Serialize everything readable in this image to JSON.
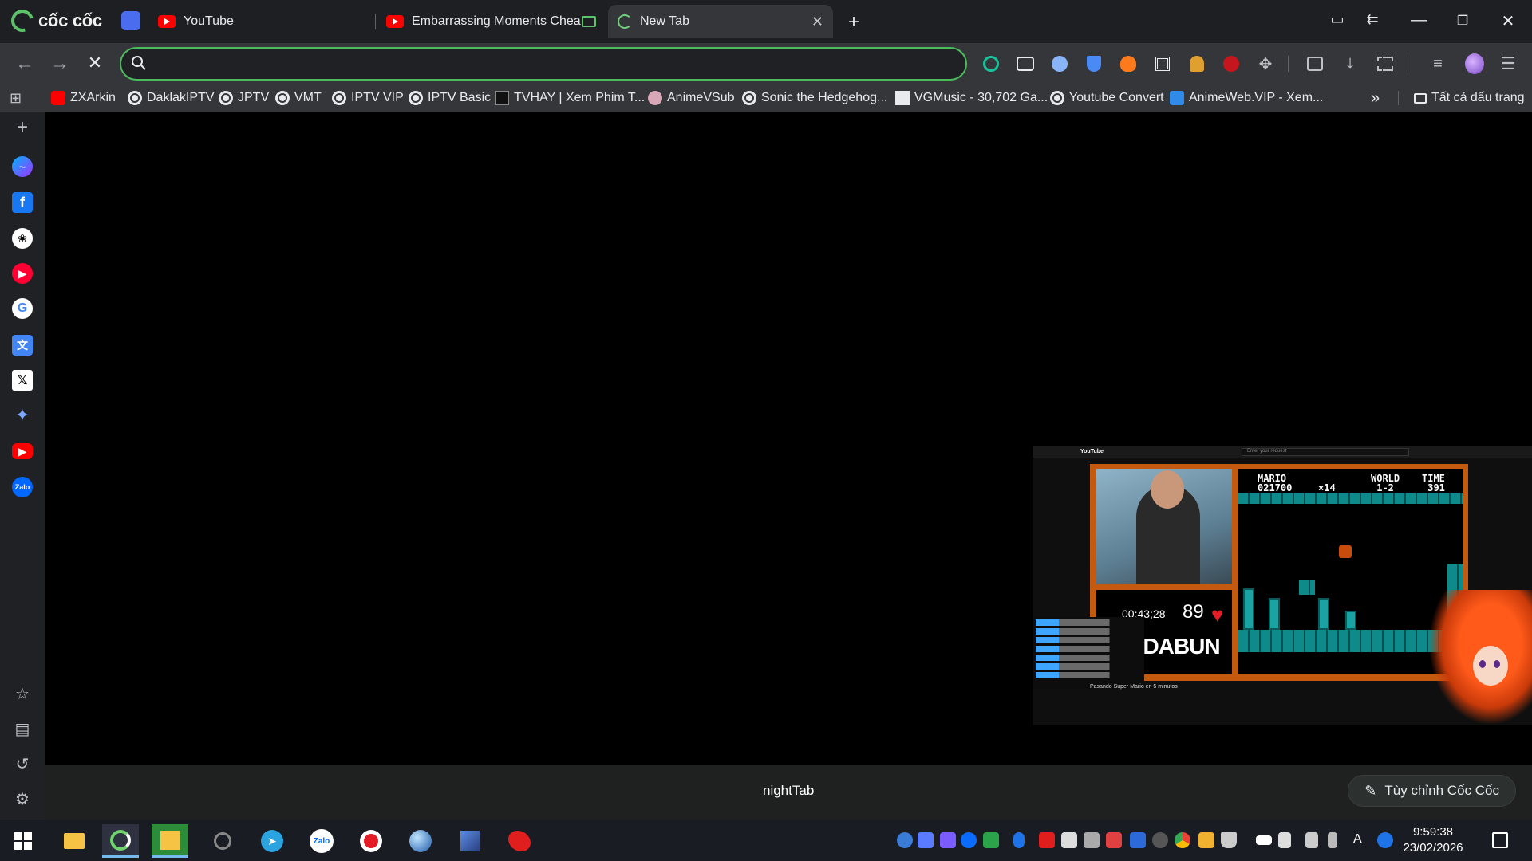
{
  "browser": {
    "brand_name": "cốc cốc",
    "tabs": [
      {
        "label": "YouTube",
        "icon": "youtube-icon"
      },
      {
        "label": "Embarrassing Moments Chea",
        "icon": "youtube-icon",
        "pip_indicator": true
      },
      {
        "label": "New Tab",
        "icon": "loading-spinner-icon",
        "active": true
      }
    ],
    "window_controls": [
      "minimize",
      "restore",
      "close"
    ]
  },
  "omnibox": {
    "value": "",
    "placeholder": "",
    "icon": "search-icon"
  },
  "extensions": [
    "grammarly-icon",
    "vpn-glasses-icon",
    "circle-icon",
    "shield-icon",
    "coccoc-fox-icon",
    "qr-icon",
    "people-icon",
    "adblock-icon",
    "puzzle-icon",
    "split-view-icon",
    "download-icon",
    "screenshot-icon",
    "media-control-icon",
    "profile-avatar",
    "menu-icon"
  ],
  "bookmarks": {
    "items": [
      {
        "label": "ZXArkin",
        "icon": "youtube-icon"
      },
      {
        "label": "DaklakIPTV",
        "icon": "globe-icon"
      },
      {
        "label": "JPTV",
        "icon": "globe-icon"
      },
      {
        "label": "VMT",
        "icon": "globe-icon"
      },
      {
        "label": "IPTV VIP",
        "icon": "globe-icon"
      },
      {
        "label": "IPTV Basic",
        "icon": "globe-icon"
      },
      {
        "label": "TVHAY | Xem Phim T...",
        "icon": "tvhay-icon"
      },
      {
        "label": "AnimeVSub",
        "icon": "animevsub-icon"
      },
      {
        "label": "Sonic the Hedgehog...",
        "icon": "globe-icon"
      },
      {
        "label": "VGMusic - 30,702 Ga...",
        "icon": "vgmusic-icon"
      },
      {
        "label": "Youtube Convert",
        "icon": "globe-icon"
      },
      {
        "label": "AnimeWeb.VIP - Xem...",
        "icon": "animeweb-icon"
      }
    ],
    "overflow": "»",
    "all_bookmarks": "Tất cả dấu trang"
  },
  "sidebar": {
    "add": "+",
    "apps": [
      "messenger-icon",
      "facebook-icon",
      "chatgpt-icon",
      "youtube-music-icon",
      "google-icon",
      "google-translate-icon",
      "x-icon",
      "gemini-icon",
      "youtube-icon",
      "zalo-icon"
    ],
    "zalo_label": "Zalo"
  },
  "page": {
    "footer_link": "nightTab",
    "customize_button": "Tùy chỉnh Cốc Cốc"
  },
  "pip_video": {
    "site": "YouTube",
    "search_placeholder": "Enter your request",
    "timer": "00;43;28",
    "score": "89",
    "brand": "BADABUN",
    "hud": {
      "mario": "MARIO\n021700",
      "coins": "×14",
      "world": "WORLD\n 1-2",
      "time": "TIME\n 391"
    },
    "title": "Pasando Super Mario en 5 minutos"
  },
  "taskbar": {
    "apps": [
      "windows-start-icon",
      "file-explorer-icon",
      "coccoc-browser-icon",
      "photo-app-icon",
      "edge-icon",
      "telegram-icon",
      "zalo-icon",
      "record-icon",
      "globe-app-icon",
      "image-editor-icon",
      "garena-icon"
    ],
    "clock_time": "9:59:38",
    "clock_date": "23/02/2026",
    "ime": "A",
    "colors": {
      "accent": "#76b9ed"
    }
  },
  "colors": {
    "omnibox_border": "#4cbb5d",
    "youtube_red": "#ff0000",
    "content_bg": "#000000"
  }
}
